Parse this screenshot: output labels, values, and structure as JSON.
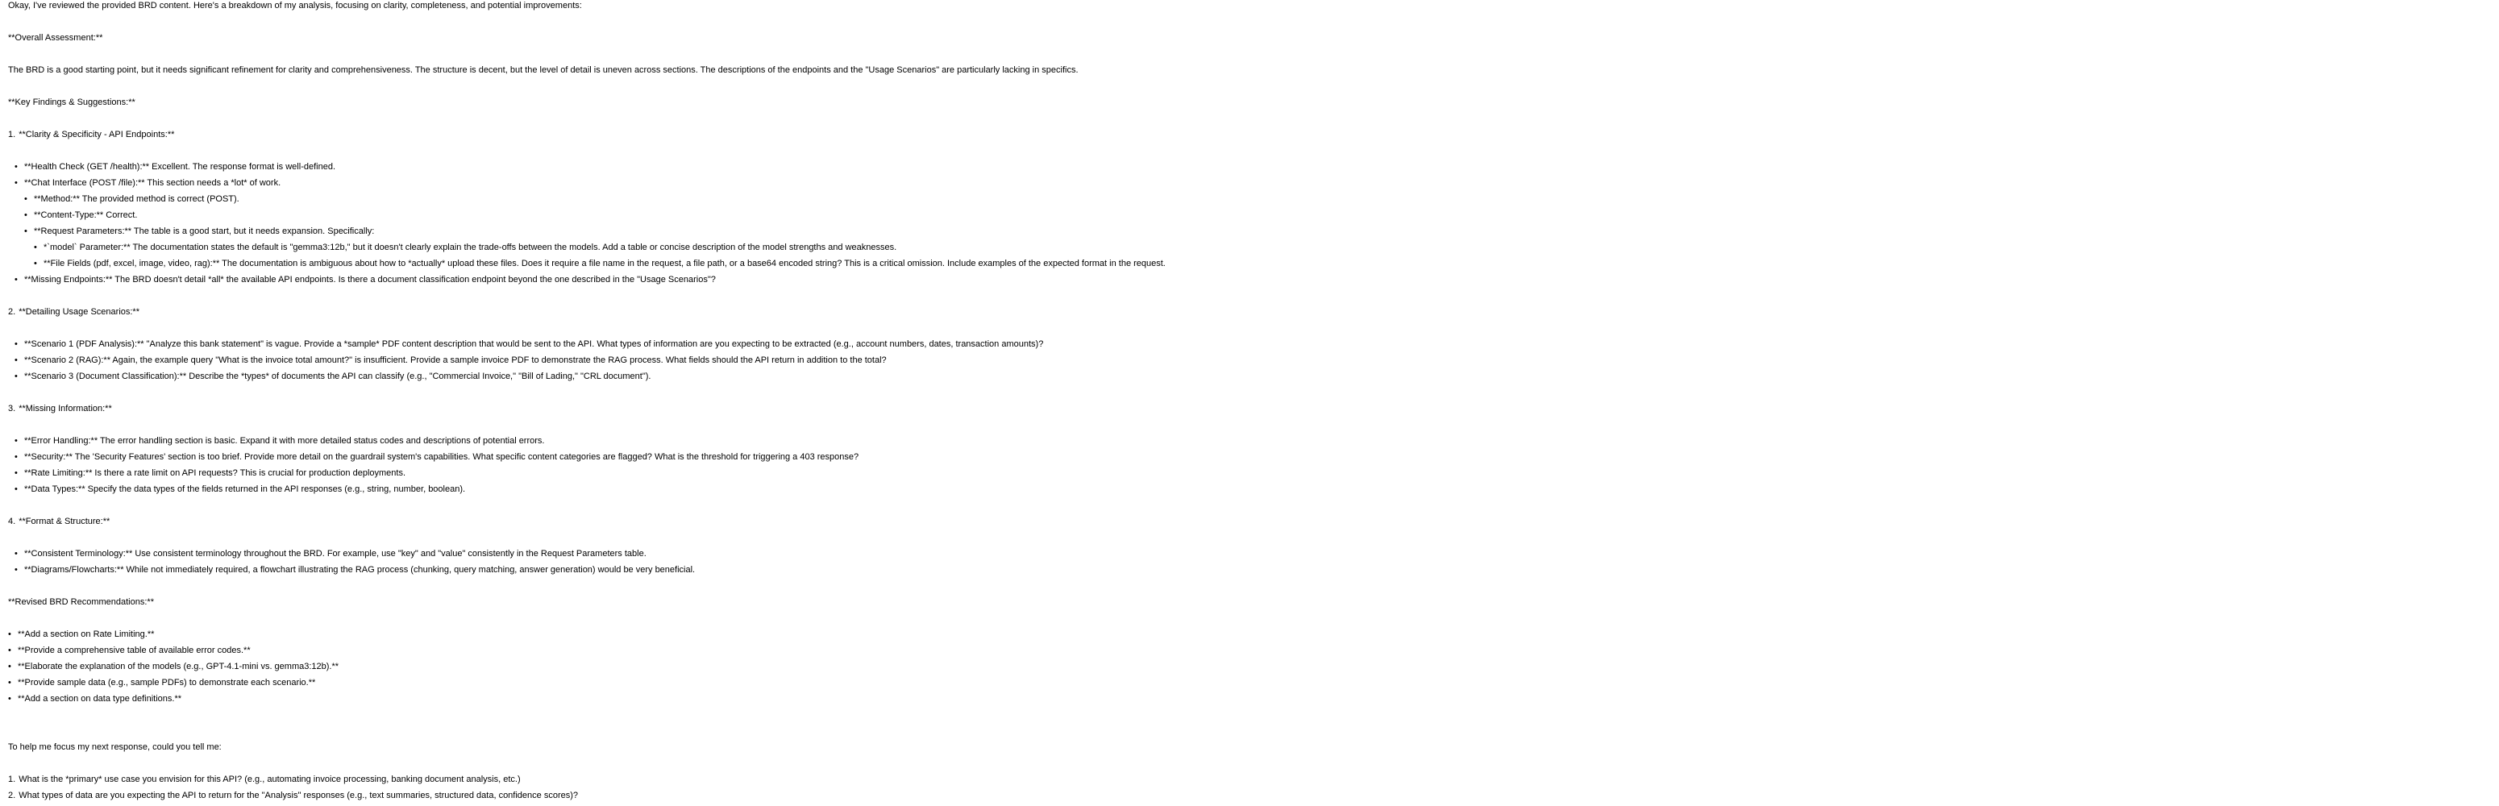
{
  "intro": "Okay, I've reviewed the provided BRD content. Here's a breakdown of my analysis, focusing on clarity, completeness, and potential improvements:",
  "overall_heading": "**Overall Assessment:**",
  "overall_text": "The BRD is a good starting point, but it needs significant refinement for clarity and comprehensiveness. The structure is decent, but the level of detail is uneven across sections. The descriptions of the endpoints and the \"Usage Scenarios\" are particularly lacking in specifics.",
  "findings_heading": "**Key Findings & Suggestions:**",
  "sections": [
    {
      "number": "1.",
      "title": "**Clarity & Specificity - API Endpoints:**",
      "items": [
        {
          "text": "**Health Check (GET /health):** Excellent. The response format is well-defined."
        },
        {
          "text": "**Chat Interface (POST /file):** This section needs a *lot* of work."
        },
        {
          "text": "**Method:** The provided method is correct (POST)."
        },
        {
          "text": "**Content-Type:** Correct."
        },
        {
          "text": "**Request Parameters:** The table is a good start, but it needs expansion. Specifically:"
        },
        {
          "text": "*`model` Parameter:** The documentation states the default is \"gemma3:12b,\" but it doesn't clearly explain the trade-offs between the models. Add a table or concise description of the model strengths and weaknesses."
        },
        {
          "text": "**File Fields (pdf, excel, image, video, rag):** The documentation is ambiguous about how to *actually* upload these files. Does it require a file name in the request, a file path, or a base64 encoded string? This is a critical omission. Include examples of the expected format in the request."
        },
        {
          "text": "**Missing Endpoints:** The BRD doesn't detail *all* the available API endpoints. Is there a document classification endpoint beyond the one described in the \"Usage Scenarios\"?"
        }
      ]
    },
    {
      "number": "2.",
      "title": "**Detailing Usage Scenarios:**",
      "items": [
        {
          "text": "**Scenario 1 (PDF Analysis):** \"Analyze this bank statement\" is vague. Provide a *sample* PDF content description that would be sent to the API. What types of information are you expecting to be extracted (e.g., account numbers, dates, transaction amounts)?"
        },
        {
          "text": "**Scenario 2 (RAG):** Again, the example query \"What is the invoice total amount?\" is insufficient. Provide a sample invoice PDF to demonstrate the RAG process. What fields should the API return in addition to the total?"
        },
        {
          "text": "**Scenario 3 (Document Classification):** Describe the *types* of documents the API can classify (e.g., \"Commercial Invoice,\" \"Bill of Lading,\" \"CRL document\")."
        }
      ]
    },
    {
      "number": "3.",
      "title": "**Missing Information:**",
      "items": [
        {
          "text": "**Error Handling:** The error handling section is basic. Expand it with more detailed status codes and descriptions of potential errors."
        },
        {
          "text": "**Security:** The 'Security Features' section is too brief. Provide more detail on the guardrail system's capabilities. What specific content categories are flagged? What is the threshold for triggering a 403 response?"
        },
        {
          "text": "**Rate Limiting:** Is there a rate limit on API requests? This is crucial for production deployments."
        },
        {
          "text": "**Data Types:** Specify the data types of the fields returned in the API responses (e.g., string, number, boolean)."
        }
      ]
    },
    {
      "number": "4.",
      "title": "**Format & Structure:**",
      "items": [
        {
          "text": "**Consistent Terminology:** Use consistent terminology throughout the BRD. For example, use \"key\" and \"value\" consistently in the Request Parameters table."
        },
        {
          "text": "**Diagrams/Flowcharts:** While not immediately required, a flowchart illustrating the RAG process (chunking, query matching, answer generation) would be very beneficial."
        }
      ]
    }
  ],
  "revised_heading": "**Revised BRD Recommendations:**",
  "revised_items": [
    "**Add a section on Rate Limiting.**",
    "**Provide a comprehensive table of available error codes.**",
    "**Elaborate the explanation of the models (e.g., GPT-4.1-mini vs. gemma3:12b).**",
    "**Provide sample data (e.g., sample PDFs) to demonstrate each scenario.**",
    "**Add a section on data type definitions.**"
  ],
  "followup_intro": "To help me focus my next response, could you tell me:",
  "questions": [
    {
      "number": "1.",
      "text": "What is the *primary* use case you envision for this API? (e.g., automating invoice processing, banking document analysis, etc.)"
    },
    {
      "number": "2.",
      "text": "What types of data are you expecting the API to return for the \"Analysis\" responses (e.g., text summaries, structured data, confidence scores)?"
    }
  ]
}
